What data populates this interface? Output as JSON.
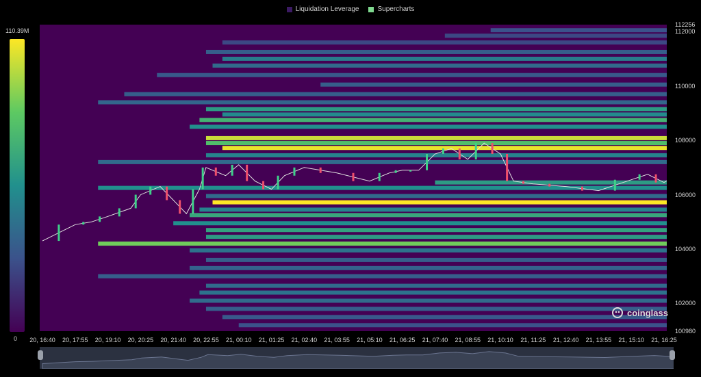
{
  "legend": {
    "items": [
      {
        "label": "Liquidation Leverage",
        "color": "#3b1a63"
      },
      {
        "label": "Supercharts",
        "color": "#7fd98f"
      }
    ]
  },
  "colorbar": {
    "max_label": "110.39M",
    "min_label": "0",
    "colors": [
      "#440154",
      "#3b528b",
      "#21908d",
      "#5dc962",
      "#fde725"
    ]
  },
  "watermark": "coinglass",
  "chart_data": {
    "type": "heatmap",
    "title": "",
    "ylim": [
      100980,
      112256
    ],
    "y_ticks": [
      "112256",
      "112000",
      "110000",
      "108000",
      "106000",
      "104000",
      "102000",
      "100980"
    ],
    "x_ticks": [
      "20, 16:40",
      "20, 17:55",
      "20, 19:10",
      "20, 20:25",
      "20, 21:40",
      "20, 22:55",
      "21, 00:10",
      "21, 01:25",
      "21, 02:40",
      "21, 03:55",
      "21, 05:10",
      "21, 06:25",
      "21, 07:40",
      "21, 08:55",
      "21, 10:10",
      "21, 11:25",
      "21, 12:40",
      "21, 13:55",
      "21, 15:10",
      "21, 16:25"
    ],
    "price_series": [
      {
        "t": 0,
        "p": 104300
      },
      {
        "t": 1,
        "p": 104900
      },
      {
        "t": 1.5,
        "p": 105000
      },
      {
        "t": 2,
        "p": 105200
      },
      {
        "t": 2.7,
        "p": 105500
      },
      {
        "t": 3,
        "p": 106000
      },
      {
        "t": 3.6,
        "p": 106300
      },
      {
        "t": 4,
        "p": 105800
      },
      {
        "t": 4.4,
        "p": 105300
      },
      {
        "t": 4.8,
        "p": 106200
      },
      {
        "t": 5,
        "p": 107000
      },
      {
        "t": 5.6,
        "p": 106700
      },
      {
        "t": 6,
        "p": 107100
      },
      {
        "t": 6.5,
        "p": 106500
      },
      {
        "t": 7,
        "p": 106200
      },
      {
        "t": 7.4,
        "p": 106700
      },
      {
        "t": 8,
        "p": 107000
      },
      {
        "t": 9,
        "p": 106800
      },
      {
        "t": 10,
        "p": 106500
      },
      {
        "t": 10.6,
        "p": 106800
      },
      {
        "t": 11,
        "p": 106900
      },
      {
        "t": 11.5,
        "p": 106900
      },
      {
        "t": 12,
        "p": 107500
      },
      {
        "t": 12.5,
        "p": 107700
      },
      {
        "t": 13,
        "p": 107300
      },
      {
        "t": 13.5,
        "p": 107900
      },
      {
        "t": 14,
        "p": 107500
      },
      {
        "t": 14.4,
        "p": 106500
      },
      {
        "t": 15,
        "p": 106400
      },
      {
        "t": 16,
        "p": 106300
      },
      {
        "t": 17,
        "p": 106150
      },
      {
        "t": 18,
        "p": 106550
      },
      {
        "t": 18.5,
        "p": 106750
      },
      {
        "t": 19,
        "p": 106450
      },
      {
        "t": 19.4,
        "p": 106750
      }
    ],
    "liquidation_bands": [
      {
        "price": 112050,
        "start": 13.7,
        "intensity": 0.25
      },
      {
        "price": 111850,
        "start": 12.3,
        "intensity": 0.22
      },
      {
        "price": 111600,
        "start": 5.5,
        "intensity": 0.22
      },
      {
        "price": 111250,
        "start": 5.0,
        "intensity": 0.3
      },
      {
        "price": 111000,
        "start": 5.5,
        "intensity": 0.42
      },
      {
        "price": 110750,
        "start": 5.2,
        "intensity": 0.35
      },
      {
        "price": 110400,
        "start": 3.5,
        "intensity": 0.28
      },
      {
        "price": 110050,
        "start": 8.5,
        "intensity": 0.3
      },
      {
        "price": 109700,
        "start": 2.5,
        "intensity": 0.3
      },
      {
        "price": 109400,
        "start": 1.7,
        "intensity": 0.33
      },
      {
        "price": 109150,
        "start": 5.0,
        "intensity": 0.55
      },
      {
        "price": 108950,
        "start": 5.5,
        "intensity": 0.48
      },
      {
        "price": 108750,
        "start": 4.8,
        "intensity": 0.65
      },
      {
        "price": 108500,
        "start": 4.5,
        "intensity": 0.5
      },
      {
        "price": 108080,
        "start": 5.0,
        "intensity": 0.92
      },
      {
        "price": 107900,
        "start": 5.0,
        "intensity": 0.7
      },
      {
        "price": 107720,
        "start": 5.5,
        "intensity": 0.97
      },
      {
        "price": 107450,
        "start": 5.0,
        "intensity": 0.45
      },
      {
        "price": 107200,
        "start": 1.7,
        "intensity": 0.35
      },
      {
        "price": 106450,
        "start": 12.0,
        "intensity": 0.55
      },
      {
        "price": 106250,
        "start": 1.7,
        "intensity": 0.5
      },
      {
        "price": 105950,
        "start": 5.0,
        "intensity": 0.35
      },
      {
        "price": 105720,
        "start": 5.2,
        "intensity": 1.0
      },
      {
        "price": 105450,
        "start": 4.8,
        "intensity": 0.45
      },
      {
        "price": 105250,
        "start": 4.5,
        "intensity": 0.6
      },
      {
        "price": 104950,
        "start": 4.0,
        "intensity": 0.5
      },
      {
        "price": 104700,
        "start": 5.0,
        "intensity": 0.58
      },
      {
        "price": 104450,
        "start": 5.0,
        "intensity": 0.55
      },
      {
        "price": 104200,
        "start": 1.7,
        "intensity": 0.78
      },
      {
        "price": 103950,
        "start": 4.5,
        "intensity": 0.38
      },
      {
        "price": 103600,
        "start": 5.0,
        "intensity": 0.3
      },
      {
        "price": 103300,
        "start": 4.5,
        "intensity": 0.32
      },
      {
        "price": 103000,
        "start": 1.7,
        "intensity": 0.3
      },
      {
        "price": 102650,
        "start": 5.0,
        "intensity": 0.35
      },
      {
        "price": 102400,
        "start": 4.8,
        "intensity": 0.38
      },
      {
        "price": 102100,
        "start": 4.5,
        "intensity": 0.35
      },
      {
        "price": 101800,
        "start": 5.0,
        "intensity": 0.3
      },
      {
        "price": 101500,
        "start": 5.5,
        "intensity": 0.28
      },
      {
        "price": 101200,
        "start": 6.0,
        "intensity": 0.25
      }
    ]
  }
}
